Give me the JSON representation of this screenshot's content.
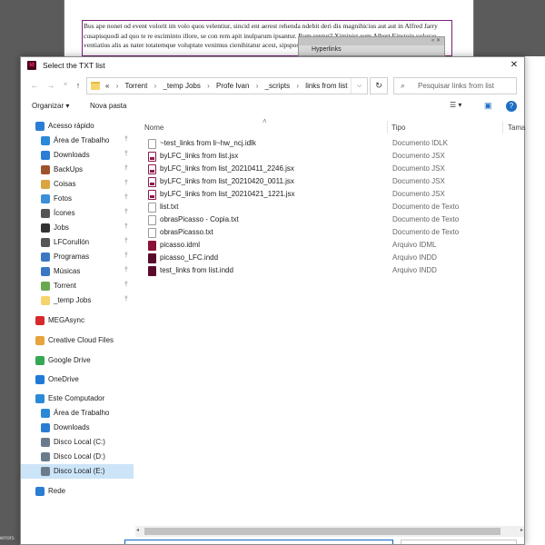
{
  "background": {
    "document_text": "Bus ape nonet od event volorit im volo quos velentiur, sincid ent aerest rehenda ndebit deri dis magnihicius aut aut in Alfred Jarry cusapisquodi ad quo te re esciminto illore, se con rem apit inulparum ipsantur. Rum reptur? Ximinist eum Albert Einstein volorae ventiatius alis as nater totatemque voluptate venimus cienihitatur acest, sipspos prori atquesequat",
    "hyperlinks_panel_label": "Hyperlinks",
    "panel_controls": "« ✕",
    "status_text": "errors"
  },
  "dialog": {
    "title": "Select the TXT list",
    "app_icon_label": "Id",
    "close_glyph": "✕"
  },
  "navigation": {
    "back_glyph": "←",
    "forward_glyph": "→",
    "recent_glyph": "˅",
    "up_glyph": "↑",
    "refresh_glyph": "↻",
    "breadcrumb_lead": "«",
    "breadcrumbs": [
      "Torrent",
      "_temp Jobs",
      "Profe Ivan",
      "_scripts",
      "links from list"
    ],
    "search_placeholder": "Pesquisar links from list"
  },
  "toolbar": {
    "organize_label": "Organizar ▾",
    "new_folder_label": "Nova pasta",
    "view_glyph": "☰ ▾",
    "preview_glyph": "▣",
    "help_glyph": "?"
  },
  "sidebar": {
    "items": [
      {
        "label": "Acesso rápido",
        "icon": "star-icon",
        "color": "#2b7cd3",
        "pinned": false,
        "indent": 0,
        "chev": true
      },
      {
        "label": "Área de Trabalho",
        "icon": "desktop-icon",
        "color": "#2b8ad8",
        "pinned": true,
        "indent": 1,
        "chev": false
      },
      {
        "label": "Downloads",
        "icon": "download-icon",
        "color": "#2b7cd3",
        "pinned": true,
        "indent": 1,
        "chev": false
      },
      {
        "label": "BackUps",
        "icon": "folder-icon",
        "color": "#a0522d",
        "pinned": true,
        "indent": 1,
        "chev": false
      },
      {
        "label": "Coisas",
        "icon": "box-icon",
        "color": "#d9a441",
        "pinned": true,
        "indent": 1,
        "chev": false
      },
      {
        "label": "Fotos",
        "icon": "photos-icon",
        "color": "#3a8fd6",
        "pinned": true,
        "indent": 1,
        "chev": false
      },
      {
        "label": "Ícones",
        "icon": "folder-icon",
        "color": "#555555",
        "pinned": true,
        "indent": 1,
        "chev": false
      },
      {
        "label": "Jobs",
        "icon": "jobs-icon",
        "color": "#333333",
        "pinned": true,
        "indent": 1,
        "chev": false
      },
      {
        "label": "LFCorullón",
        "icon": "lfc-icon",
        "color": "#555555",
        "pinned": true,
        "indent": 1,
        "chev": false
      },
      {
        "label": "Programas",
        "icon": "programs-icon",
        "color": "#3a78c4",
        "pinned": true,
        "indent": 1,
        "chev": false
      },
      {
        "label": "Músicas",
        "icon": "music-icon",
        "color": "#3a78c4",
        "pinned": true,
        "indent": 1,
        "chev": false
      },
      {
        "label": "Torrent",
        "icon": "torrent-icon",
        "color": "#6aa84f",
        "pinned": true,
        "indent": 1,
        "chev": false
      },
      {
        "label": "_temp Jobs",
        "icon": "folder-icon",
        "color": "#f6d46c",
        "pinned": true,
        "indent": 1,
        "chev": false
      },
      {
        "label": "MEGAsync",
        "icon": "mega-icon",
        "color": "#d9272e",
        "pinned": false,
        "indent": 0,
        "chev": true
      },
      {
        "label": "Creative Cloud Files",
        "icon": "cc-folder-icon",
        "color": "#e8a33c",
        "pinned": false,
        "indent": 0,
        "chev": true
      },
      {
        "label": "Google Drive",
        "icon": "drive-icon",
        "color": "#34a853",
        "pinned": false,
        "indent": 0,
        "chev": true
      },
      {
        "label": "OneDrive",
        "icon": "cloud-icon",
        "color": "#1e7ad6",
        "pinned": false,
        "indent": 0,
        "chev": true
      },
      {
        "label": "Este Computador",
        "icon": "computer-icon",
        "color": "#2b8ad8",
        "pinned": false,
        "indent": 0,
        "chev": true
      },
      {
        "label": "Área de Trabalho",
        "icon": "desktop-icon",
        "color": "#2b8ad8",
        "pinned": false,
        "indent": 1,
        "chev": true
      },
      {
        "label": "Downloads",
        "icon": "download-icon",
        "color": "#2b7cd3",
        "pinned": false,
        "indent": 1,
        "chev": true
      },
      {
        "label": "Disco Local (C:)",
        "icon": "drive-c-icon",
        "color": "#6a7b8c",
        "pinned": false,
        "indent": 1,
        "chev": true
      },
      {
        "label": "Disco Local (D:)",
        "icon": "drive-d-icon",
        "color": "#6a7b8c",
        "pinned": false,
        "indent": 1,
        "chev": true
      },
      {
        "label": "Disco Local (E:)",
        "icon": "drive-e-icon",
        "color": "#6a7b8c",
        "pinned": false,
        "indent": 1,
        "chev": true,
        "selected": true
      },
      {
        "label": "Rede",
        "icon": "network-icon",
        "color": "#2b7cd3",
        "pinned": false,
        "indent": 0,
        "chev": true
      }
    ]
  },
  "filelist": {
    "columns": {
      "name": "Nome",
      "type": "Tipo",
      "size": "Tama"
    },
    "sort_glyph": "˄",
    "files": [
      {
        "name": "~test_links from li~hw_ncj.idlk",
        "type": "Documento IDLK",
        "icon": "ic-doc"
      },
      {
        "name": "byLFC_links from list.jsx",
        "type": "Documento JSX",
        "icon": "ic-jsx"
      },
      {
        "name": "byLFC_links from list_20210411_2246.jsx",
        "type": "Documento JSX",
        "icon": "ic-jsx"
      },
      {
        "name": "byLFC_links from list_20210420_0011.jsx",
        "type": "Documento JSX",
        "icon": "ic-jsx"
      },
      {
        "name": "byLFC_links from list_20210421_1221.jsx",
        "type": "Documento JSX",
        "icon": "ic-jsx"
      },
      {
        "name": "list.txt",
        "type": "Documento de Texto",
        "icon": "ic-txt"
      },
      {
        "name": "obrasPicasso - Copia.txt",
        "type": "Documento de Texto",
        "icon": "ic-txt"
      },
      {
        "name": "obrasPicasso.txt",
        "type": "Documento de Texto",
        "icon": "ic-txt"
      },
      {
        "name": "picasso.idml",
        "type": "Arquivo IDML",
        "icon": "ic-idml"
      },
      {
        "name": "picasso_LFC.indd",
        "type": "Arquivo INDD",
        "icon": "ic-indd"
      },
      {
        "name": "test_links from list.indd",
        "type": "Arquivo INDD",
        "icon": "ic-indd"
      }
    ]
  },
  "scrollbar": {
    "left_glyph": "◂",
    "right_glyph": "▸"
  },
  "colors": {
    "accent": "#0a64c8",
    "selection": "#cce4f7",
    "indesign": "#49021f"
  }
}
